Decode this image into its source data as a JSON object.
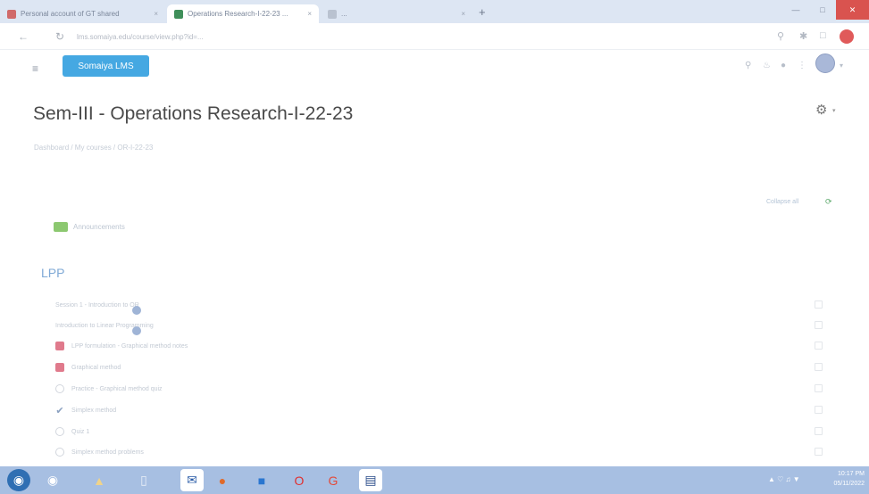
{
  "browser": {
    "tabs": [
      {
        "title": "Personal account of GT shared",
        "close": "×"
      },
      {
        "title": "Operations Research-I-22-23 ...",
        "close": "×"
      },
      {
        "title": "...",
        "close": "×"
      }
    ],
    "new_tab": "+",
    "url": "lms.somaiya.edu/course/view.php?id=..."
  },
  "lms": {
    "menu_icon": "≡",
    "brand": "Somaiya LMS"
  },
  "course": {
    "title": "Sem-III - Operations Research-I-22-23",
    "breadcrumb": "Dashboard / My courses / OR-I-22-23",
    "collapse_all": "Collapse all",
    "forum_label": "Announcements",
    "section": "LPP",
    "activities": [
      {
        "type": "url",
        "label": "Session 1 - Introduction to OR"
      },
      {
        "type": "url",
        "label": "Introduction to Linear Programming"
      },
      {
        "type": "pdf",
        "label": "LPP formulation - Graphical method notes"
      },
      {
        "type": "pdf",
        "label": "Graphical method"
      },
      {
        "type": "quiz",
        "label": "Practice - Graphical method quiz"
      },
      {
        "type": "check",
        "label": "Simplex method"
      },
      {
        "type": "quiz",
        "label": "Quiz 1"
      },
      {
        "type": "quiz",
        "label": "Simplex method problems"
      }
    ]
  },
  "taskbar": {
    "clock_time": "10:17 PM",
    "clock_date": "05/11/2022"
  },
  "colors": {
    "brand": "#45a8e2",
    "section": "#7fa9d6",
    "taskbar": "#a7bfe2"
  }
}
